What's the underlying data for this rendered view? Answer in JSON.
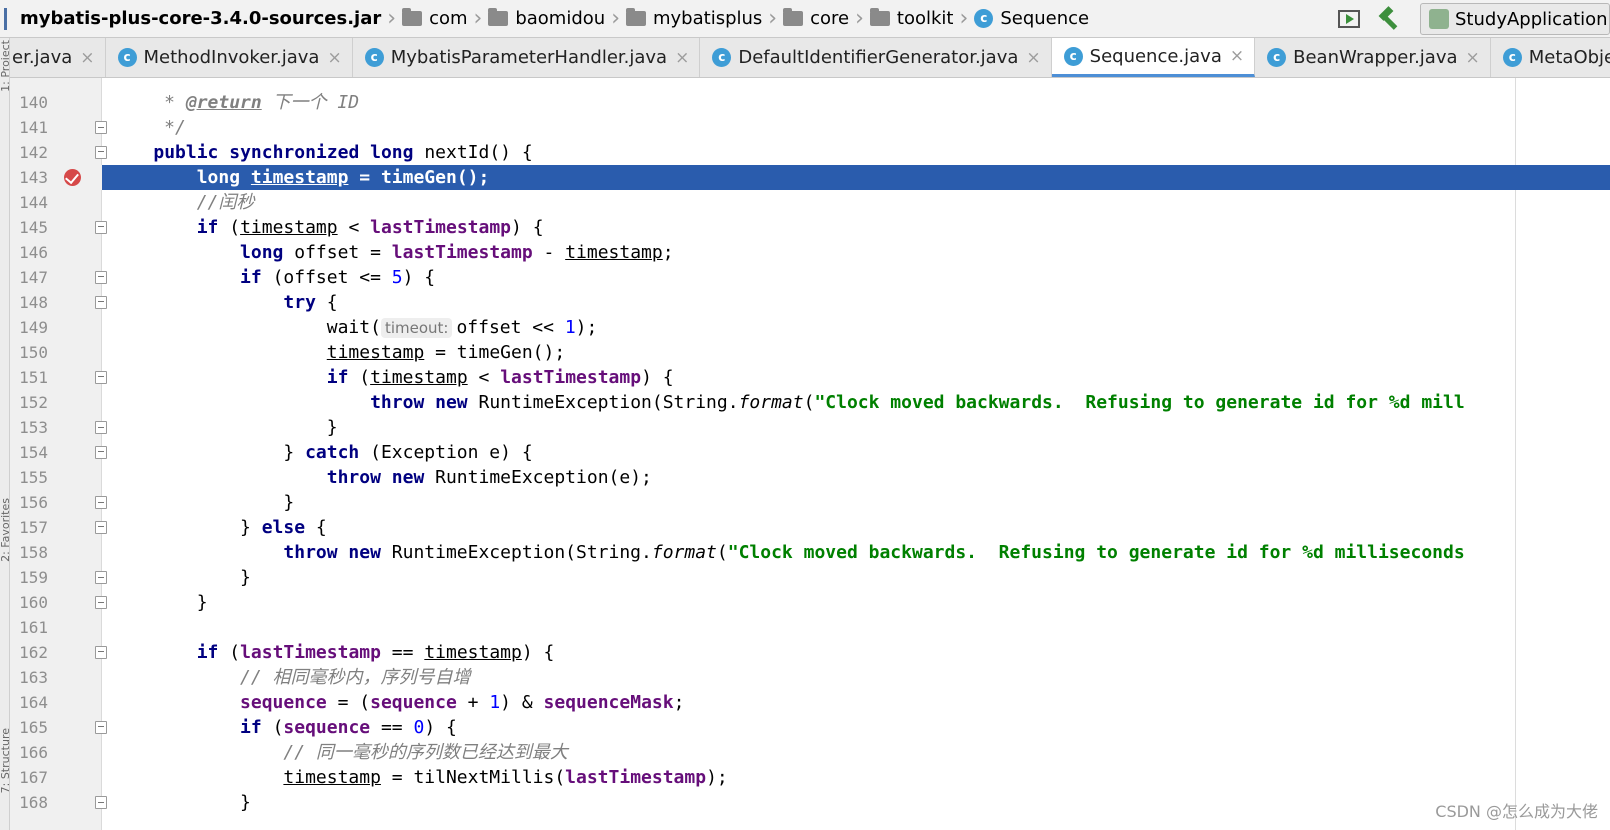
{
  "breadcrumb": {
    "root": "mybatis-plus-core-3.4.0-sources.jar",
    "folders": [
      "com",
      "baomidou",
      "mybatisplus",
      "core",
      "toolkit"
    ],
    "file": "Sequence",
    "file_icon_letter": "c"
  },
  "toolbar": {
    "run_config_label": "StudyApplication",
    "run_icon": "run-panel-icon",
    "build_icon": "hammer-icon"
  },
  "tabs": [
    {
      "label": "er.java",
      "icon": false,
      "active": false
    },
    {
      "label": "MethodInvoker.java",
      "icon": true,
      "active": false
    },
    {
      "label": "MybatisParameterHandler.java",
      "icon": true,
      "active": false
    },
    {
      "label": "DefaultIdentifierGenerator.java",
      "icon": true,
      "active": false
    },
    {
      "label": "Sequence.java",
      "icon": true,
      "active": true
    },
    {
      "label": "BeanWrapper.java",
      "icon": true,
      "active": false
    },
    {
      "label": "MetaObject.java",
      "icon": true,
      "active": false
    }
  ],
  "side_strip_labels": [
    "1: Project",
    "2: Favorites",
    "7: Structure"
  ],
  "editor": {
    "current_line": 143,
    "breakpoint_line": 143,
    "inlay_hint": "timeout:",
    "lines": [
      {
        "n": "140",
        "text": "     * @return 下一个 ID"
      },
      {
        "n": "141",
        "text": "     */"
      },
      {
        "n": "142",
        "text": "    public synchronized long nextId() {"
      },
      {
        "n": "143",
        "text": "        long timestamp = timeGen();"
      },
      {
        "n": "144",
        "text": "        //闰秒"
      },
      {
        "n": "145",
        "text": "        if (timestamp < lastTimestamp) {"
      },
      {
        "n": "146",
        "text": "            long offset = lastTimestamp - timestamp;"
      },
      {
        "n": "147",
        "text": "            if (offset <= 5) {"
      },
      {
        "n": "148",
        "text": "                try {"
      },
      {
        "n": "149",
        "text": "                    wait( offset << 1);"
      },
      {
        "n": "150",
        "text": "                    timestamp = timeGen();"
      },
      {
        "n": "151",
        "text": "                    if (timestamp < lastTimestamp) {"
      },
      {
        "n": "152",
        "text": "                        throw new RuntimeException(String.format(\"Clock moved backwards.  Refusing to generate id for %d mill"
      },
      {
        "n": "153",
        "text": "                    }"
      },
      {
        "n": "154",
        "text": "                } catch (Exception e) {"
      },
      {
        "n": "155",
        "text": "                    throw new RuntimeException(e);"
      },
      {
        "n": "156",
        "text": "                }"
      },
      {
        "n": "157",
        "text": "            } else {"
      },
      {
        "n": "158",
        "text": "                throw new RuntimeException(String.format(\"Clock moved backwards.  Refusing to generate id for %d milliseconds"
      },
      {
        "n": "159",
        "text": "            }"
      },
      {
        "n": "160",
        "text": "        }"
      },
      {
        "n": "161",
        "text": ""
      },
      {
        "n": "162",
        "text": "        if (lastTimestamp == timestamp) {"
      },
      {
        "n": "163",
        "text": "            // 相同毫秒内，序列号自增"
      },
      {
        "n": "164",
        "text": "            sequence = (sequence + 1) & sequenceMask;"
      },
      {
        "n": "165",
        "text": "            if (sequence == 0) {"
      },
      {
        "n": "166",
        "text": "                // 同一毫秒的序列数已经达到最大"
      },
      {
        "n": "167",
        "text": "                timestamp = tilNextMillis(lastTimestamp);"
      },
      {
        "n": "168",
        "text": "            }"
      }
    ]
  },
  "watermark": "CSDN @怎么成为大佬"
}
